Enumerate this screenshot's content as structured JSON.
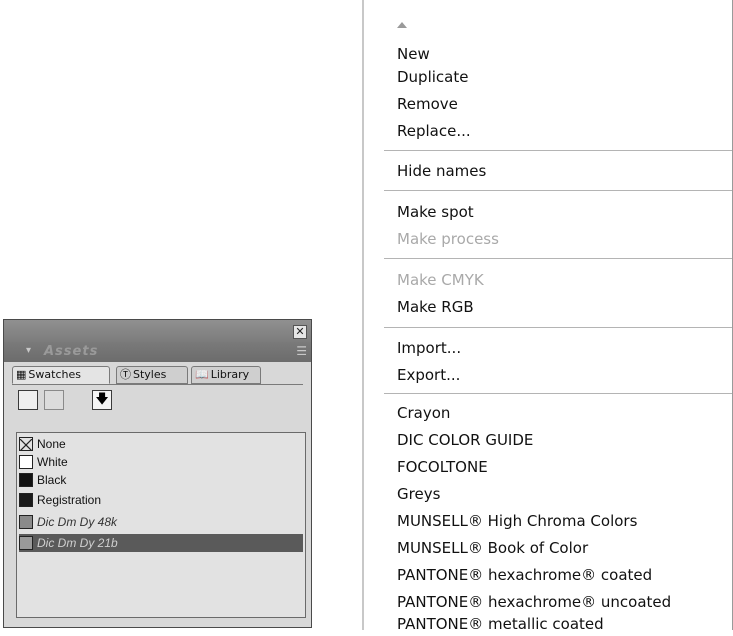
{
  "assets_panel": {
    "close_glyph": "✕",
    "collapse_glyph": "▾",
    "title": "Assets",
    "menu_glyph": "☰",
    "tabs": [
      {
        "label": "Swatches",
        "icon": "grid-icon"
      },
      {
        "label": "Styles",
        "icon": "styles-icon"
      },
      {
        "label": "Library",
        "icon": "book-icon"
      }
    ],
    "tools": {
      "apply_glyph": "🡇"
    },
    "swatches": [
      {
        "name": "None",
        "color": "none"
      },
      {
        "name": "White",
        "color": "#ffffff"
      },
      {
        "name": "Black",
        "color": "#111111"
      },
      {
        "name": "Registration",
        "color": "#1a1a1a"
      },
      {
        "name": "Dic Dm Dy 48k",
        "color": "#8a8a8a"
      },
      {
        "name": "Dic Dm Dy 21b",
        "color": "#9a9a9a",
        "selected": true
      }
    ]
  },
  "menu": {
    "scroll_up": "up-arrow",
    "items": [
      {
        "label": "New",
        "enabled": true
      },
      {
        "label": "Duplicate",
        "enabled": true
      },
      {
        "label": "Remove",
        "enabled": true
      },
      {
        "label": "Replace...",
        "enabled": true
      },
      {
        "label": "Hide names",
        "enabled": true
      },
      {
        "label": "Make spot",
        "enabled": true
      },
      {
        "label": "Make process",
        "enabled": false
      },
      {
        "label": "Make CMYK",
        "enabled": false
      },
      {
        "label": "Make RGB",
        "enabled": true
      },
      {
        "label": "Import...",
        "enabled": true
      },
      {
        "label": "Export...",
        "enabled": true
      },
      {
        "label": "Crayon",
        "enabled": true
      },
      {
        "label": "DIC COLOR GUIDE",
        "enabled": true
      },
      {
        "label": "FOCOLTONE",
        "enabled": true
      },
      {
        "label": "Greys",
        "enabled": true
      },
      {
        "label": "MUNSELL® High Chroma Colors",
        "enabled": true
      },
      {
        "label": "MUNSELL® Book of Color",
        "enabled": true
      },
      {
        "label": "PANTONE® hexachrome® coated",
        "enabled": true
      },
      {
        "label": "PANTONE® hexachrome® uncoated",
        "enabled": true
      },
      {
        "label": "PANTONE® metallic coated",
        "enabled": true
      }
    ]
  }
}
